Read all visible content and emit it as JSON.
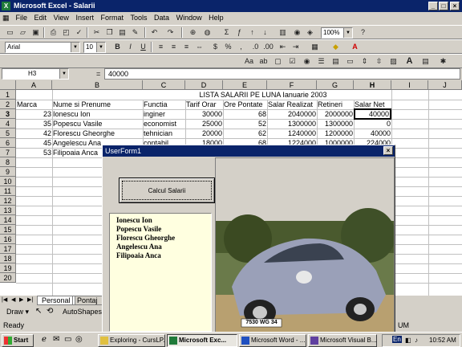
{
  "window": {
    "title": "Microsoft Excel - Salarii"
  },
  "menu": [
    "File",
    "Edit",
    "View",
    "Insert",
    "Format",
    "Tools",
    "Data",
    "Window",
    "Help"
  ],
  "toolbar": {
    "zoom": "100%",
    "font": "Arial",
    "size": "10"
  },
  "formula_bar": {
    "name_box": "H3",
    "equals": "=",
    "content": "40000"
  },
  "columns": [
    "A",
    "B",
    "C",
    "D",
    "E",
    "F",
    "G",
    "H",
    "I",
    "J"
  ],
  "rows": [
    "1",
    "2",
    "3",
    "4",
    "5",
    "6",
    "7",
    "8",
    "9",
    "10",
    "11",
    "12",
    "13",
    "14",
    "15",
    "16",
    "17",
    "18",
    "19",
    "20"
  ],
  "sheet": {
    "title": "LISTA SALARII PE LUNA Ianuarie 2003",
    "headers": [
      "Marca",
      "Nume si Prenume",
      "Functia",
      "Tarif Orar",
      "Ore Pontate",
      "Salar Realizat",
      "Retineri",
      "Salar Net"
    ],
    "data": [
      [
        "23",
        "Ionescu Ion",
        "inginer",
        "30000",
        "68",
        "2040000",
        "2000000",
        "40000"
      ],
      [
        "35",
        "Popescu Vasile",
        "economist",
        "25000",
        "52",
        "1300000",
        "1300000",
        "0"
      ],
      [
        "42",
        "Florescu Gheorghe",
        "tehnician",
        "20000",
        "62",
        "1240000",
        "1200000",
        "40000"
      ],
      [
        "45",
        "Angelescu Ana",
        "contabil",
        "18000",
        "68",
        "1224000",
        "1000000",
        "224000"
      ],
      [
        "53",
        "Filipoaia Anca",
        "",
        "",
        "",
        "",
        "",
        "",
        ""
      ]
    ]
  },
  "sheet_tabs": [
    "Personal",
    "Pontaj"
  ],
  "draw_toolbar": {
    "draw": "Draw",
    "autoshapes": "AutoShapes"
  },
  "status": {
    "left": "Ready",
    "right": "UM"
  },
  "userform": {
    "title": "UserForm1",
    "button": "Calcul Salarii",
    "list": [
      "Ionescu Ion",
      "Popescu Vasile",
      "Florescu Gheorghe",
      "Angelescu Ana",
      "Filipoaia Anca"
    ],
    "photo_plate": "7530 WG 34"
  },
  "taskbar": {
    "start": "Start",
    "tasks": [
      "Exploring - CursLP...",
      "Microsoft Exc...",
      "Microsoft Word - ...",
      "Microsoft Visual B..."
    ],
    "clock": "10:52 AM",
    "lang": "En"
  }
}
